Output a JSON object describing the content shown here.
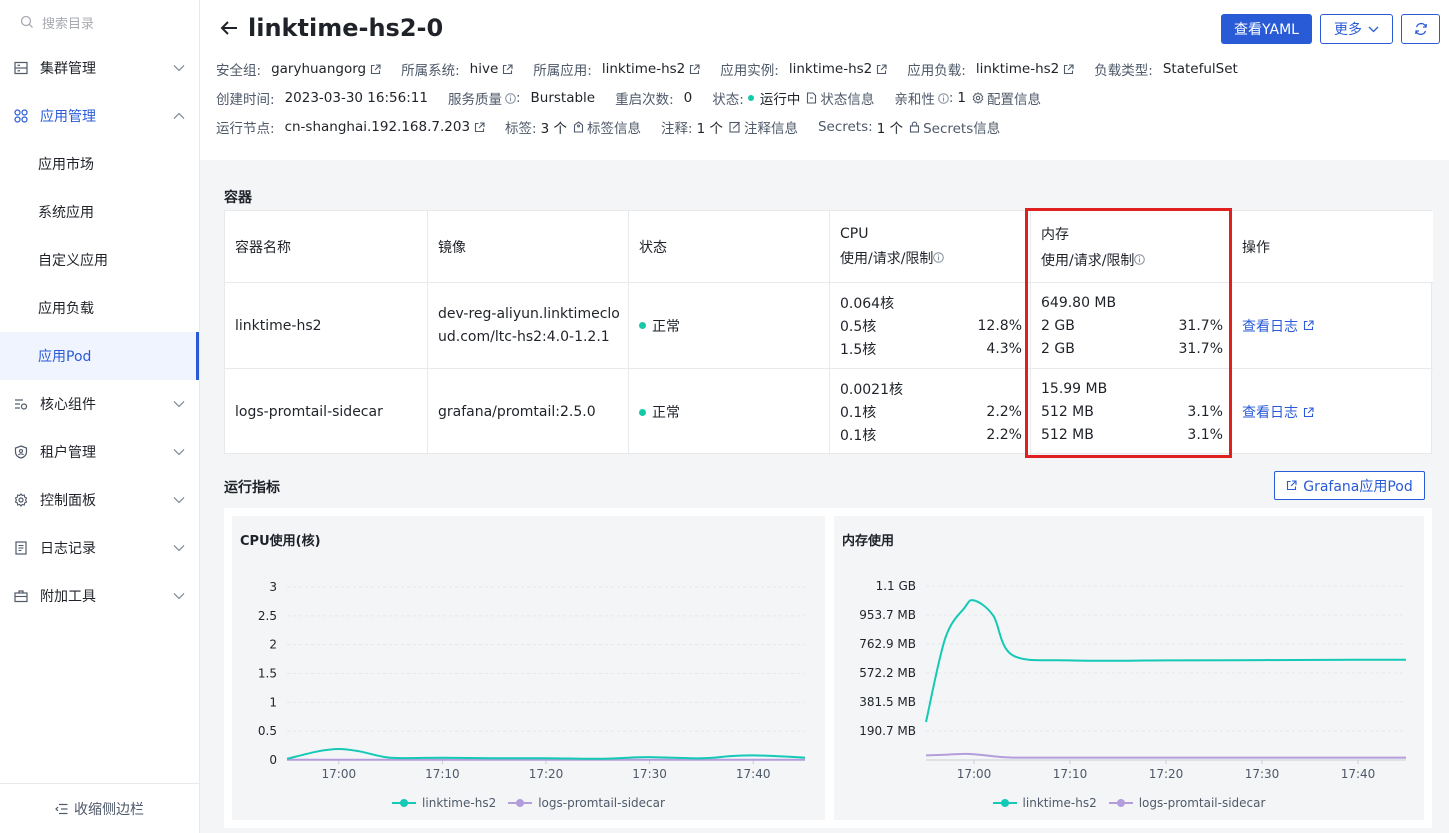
{
  "sidebar": {
    "search_placeholder": "搜索目录",
    "items": [
      {
        "label": "集群管理",
        "icon": "server-icon"
      },
      {
        "label": "应用管理",
        "icon": "apps-icon"
      },
      {
        "label": "核心组件",
        "icon": "components-icon"
      },
      {
        "label": "租户管理",
        "icon": "tenant-shield-icon"
      },
      {
        "label": "控制面板",
        "icon": "gear-icon"
      },
      {
        "label": "日志记录",
        "icon": "document-icon"
      },
      {
        "label": "附加工具",
        "icon": "toolbox-icon"
      }
    ],
    "sub_items": [
      "应用市场",
      "系统应用",
      "自定义应用",
      "应用负载",
      "应用Pod"
    ],
    "active_sub": "应用Pod",
    "collapse_label": "收缩侧边栏"
  },
  "header": {
    "title": "linktime-hs2-0",
    "btn_yaml": "查看YAML",
    "btn_more": "更多",
    "meta1": [
      {
        "k": "安全组:",
        "v": "garyhuangorg"
      },
      {
        "k": "所属系统:",
        "v": "hive"
      },
      {
        "k": "所属应用:",
        "v": "linktime-hs2"
      },
      {
        "k": "应用实例:",
        "v": "linktime-hs2"
      },
      {
        "k": "应用负载:",
        "v": "linktime-hs2"
      },
      {
        "k": "负载类型:",
        "v": "StatefulSet"
      }
    ],
    "created_k": "创建时间:",
    "created_v": "2023-03-30 16:56:11",
    "qos_k": "服务质量",
    "qos_v": "Burstable",
    "restart_k": "重启次数:",
    "restart_v": "0",
    "state_k": "状态:",
    "state_v": "运行中",
    "state_info": "状态信息",
    "affinity_k": "亲和性",
    "affinity_v": "1",
    "affinity_info": "配置信息",
    "node_k": "运行节点:",
    "node_v": "cn-shanghai.192.168.7.203",
    "labels_k": "标签:",
    "labels_v": "3 个",
    "labels_info": "标签信息",
    "notes_k": "注释:",
    "notes_v": "1 个",
    "notes_info": "注释信息",
    "secrets_k": "Secrets:",
    "secrets_v": "1 个",
    "secrets_info": "Secrets信息"
  },
  "containers": {
    "section_title": "容器",
    "headers": {
      "name": "容器名称",
      "image": "镜像",
      "status": "状态",
      "cpu": "CPU",
      "cpu_sub": "使用/请求/限制",
      "mem": "内存",
      "mem_sub": "使用/请求/限制",
      "ops": "操作"
    },
    "rows": [
      {
        "name": "linktime-hs2",
        "image": "dev-reg-aliyun.linktimecloud.com/ltc-hs2:4.0-1.2.1",
        "status": "正常",
        "cpu_use": "0.064核",
        "cpu_req": "0.5核",
        "cpu_req_pct": "12.8%",
        "cpu_lim": "1.5核",
        "cpu_lim_pct": "4.3%",
        "mem_use": "649.80 MB",
        "mem_req": "2 GB",
        "mem_req_pct": "31.7%",
        "mem_lim": "2 GB",
        "mem_lim_pct": "31.7%",
        "op": "查看日志"
      },
      {
        "name": "logs-promtail-sidecar",
        "image": "grafana/promtail:2.5.0",
        "status": "正常",
        "cpu_use": "0.0021核",
        "cpu_req": "0.1核",
        "cpu_req_pct": "2.2%",
        "cpu_lim": "0.1核",
        "cpu_lim_pct": "2.2%",
        "mem_use": "15.99 MB",
        "mem_req": "512 MB",
        "mem_req_pct": "3.1%",
        "mem_lim": "512 MB",
        "mem_lim_pct": "3.1%",
        "op": "查看日志"
      }
    ]
  },
  "metrics": {
    "section_title": "运行指标",
    "grafana_btn": "Grafana应用Pod"
  },
  "chart_data": [
    {
      "type": "line",
      "title": "CPU使用(核)",
      "x": [
        "16:55",
        "16:58",
        "17:00",
        "17:02",
        "17:05",
        "17:10",
        "17:15",
        "17:20",
        "17:25",
        "17:28",
        "17:30",
        "17:35",
        "17:38",
        "17:40",
        "17:42",
        "17:45"
      ],
      "x_ticks": [
        "17:00",
        "17:10",
        "17:20",
        "17:30",
        "17:40"
      ],
      "y_ticks": [
        "0",
        "0.5",
        "1",
        "1.5",
        "2",
        "2.5",
        "3"
      ],
      "ylim": [
        0,
        3
      ],
      "series": [
        {
          "name": "linktime-hs2",
          "color": "#14c9b5",
          "values": [
            0.02,
            0.15,
            0.19,
            0.15,
            0.04,
            0.04,
            0.03,
            0.03,
            0.02,
            0.04,
            0.05,
            0.03,
            0.07,
            0.08,
            0.07,
            0.04
          ]
        },
        {
          "name": "logs-promtail-sidecar",
          "color": "#b39ddb",
          "values": [
            0.003,
            0.003,
            0.003,
            0.003,
            0.003,
            0.003,
            0.003,
            0.003,
            0.003,
            0.003,
            0.003,
            0.003,
            0.003,
            0.003,
            0.003,
            0.003
          ]
        }
      ]
    },
    {
      "type": "line",
      "title": "内存使用",
      "x": [
        "16:55",
        "16:57",
        "16:59",
        "17:00",
        "17:02",
        "17:04",
        "17:10",
        "17:20",
        "17:30",
        "17:40",
        "17:45"
      ],
      "x_ticks": [
        "17:00",
        "17:10",
        "17:20",
        "17:30",
        "17:40"
      ],
      "y_ticks": [
        "190.7 MB",
        "381.5 MB",
        "572.2 MB",
        "762.9 MB",
        "953.7 MB",
        "1.1 GB"
      ],
      "ylim_mb": [
        0,
        1144.4
      ],
      "series": [
        {
          "name": "linktime-hs2",
          "color": "#14c9b5",
          "values_mb": [
            250,
            800,
            1000,
            1050,
            950,
            690,
            655,
            655,
            657,
            660,
            660
          ]
        },
        {
          "name": "logs-promtail-sidecar",
          "color": "#b39ddb",
          "values_mb": [
            30,
            35,
            40,
            38,
            25,
            16,
            16,
            16,
            16,
            16,
            16
          ]
        }
      ]
    }
  ]
}
